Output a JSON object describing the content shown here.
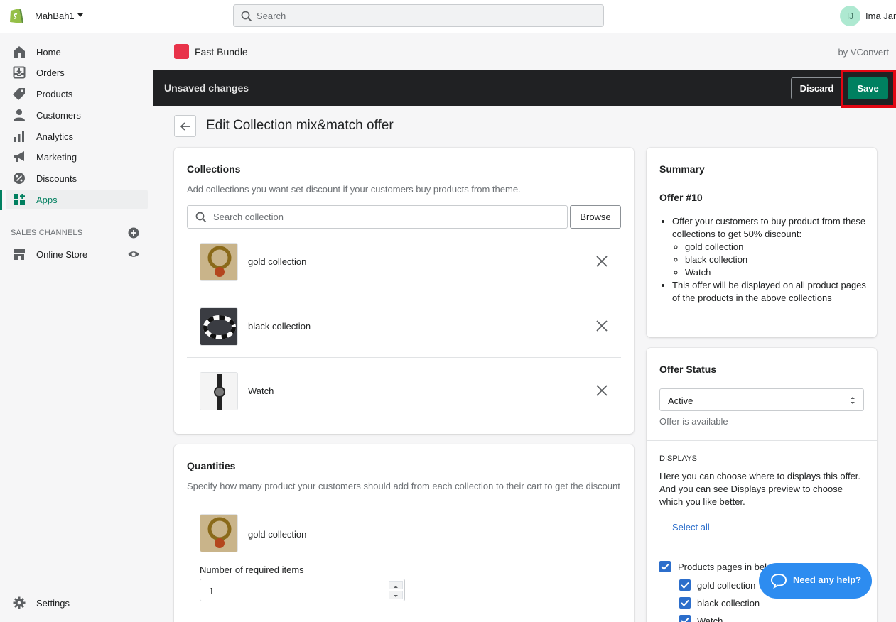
{
  "topbar": {
    "store_name": "MahBah1",
    "search_placeholder": "Search",
    "avatar_initials": "IJ",
    "user_name": "Ima Jan"
  },
  "sidebar": {
    "items": [
      {
        "label": "Home",
        "icon": "home-icon"
      },
      {
        "label": "Orders",
        "icon": "orders-icon"
      },
      {
        "label": "Products",
        "icon": "tag-icon"
      },
      {
        "label": "Customers",
        "icon": "person-icon"
      },
      {
        "label": "Analytics",
        "icon": "bar-chart-icon"
      },
      {
        "label": "Marketing",
        "icon": "megaphone-icon"
      },
      {
        "label": "Discounts",
        "icon": "discount-icon"
      },
      {
        "label": "Apps",
        "icon": "apps-icon"
      }
    ],
    "sales_channels_label": "SALES CHANNELS",
    "online_store_label": "Online Store",
    "settings_label": "Settings"
  },
  "app": {
    "name": "Fast Bundle",
    "by": "by VConvert"
  },
  "savebar": {
    "title": "Unsaved changes",
    "discard": "Discard",
    "save": "Save"
  },
  "page": {
    "title": "Edit Collection mix&match offer"
  },
  "collections": {
    "title": "Collections",
    "subtitle": "Add collections you want set discount if your customers buy products from theme.",
    "search_placeholder": "Search collection",
    "browse": "Browse",
    "items": [
      {
        "name": "gold collection"
      },
      {
        "name": "black collection"
      },
      {
        "name": "Watch"
      }
    ]
  },
  "quantities": {
    "title": "Quantities",
    "subtitle": "Specify how many product your customers should add from each collection to their cart to get the discount",
    "item_name": "gold collection",
    "required_label": "Number of required items",
    "required_value": "1"
  },
  "summary": {
    "title": "Summary",
    "offer": "Offer #10",
    "bullet1": "Offer your customers to buy product from these collections to get 50% discount:",
    "sub": [
      "gold collection",
      "black collection",
      "Watch"
    ],
    "bullet2": "This offer will be displayed on all product pages of the products in the above collections"
  },
  "status": {
    "title": "Offer Status",
    "value": "Active",
    "help": "Offer is available",
    "displays_label": "DISPLAYS",
    "displays_desc": "Here you can choose where to displays this offer. And you can see Displays preview to choose which you like better.",
    "select_all": "Select all",
    "product_pages": "Products pages in belo",
    "checks": [
      "gold collection",
      "black collection",
      "Watch"
    ]
  },
  "help": {
    "label": "Need any help?"
  },
  "colors": {
    "save_green": "#008060",
    "highlight_red": "#e30613",
    "checkbox_blue": "#2c6ecb",
    "help_blue": "#2d8cf0"
  }
}
